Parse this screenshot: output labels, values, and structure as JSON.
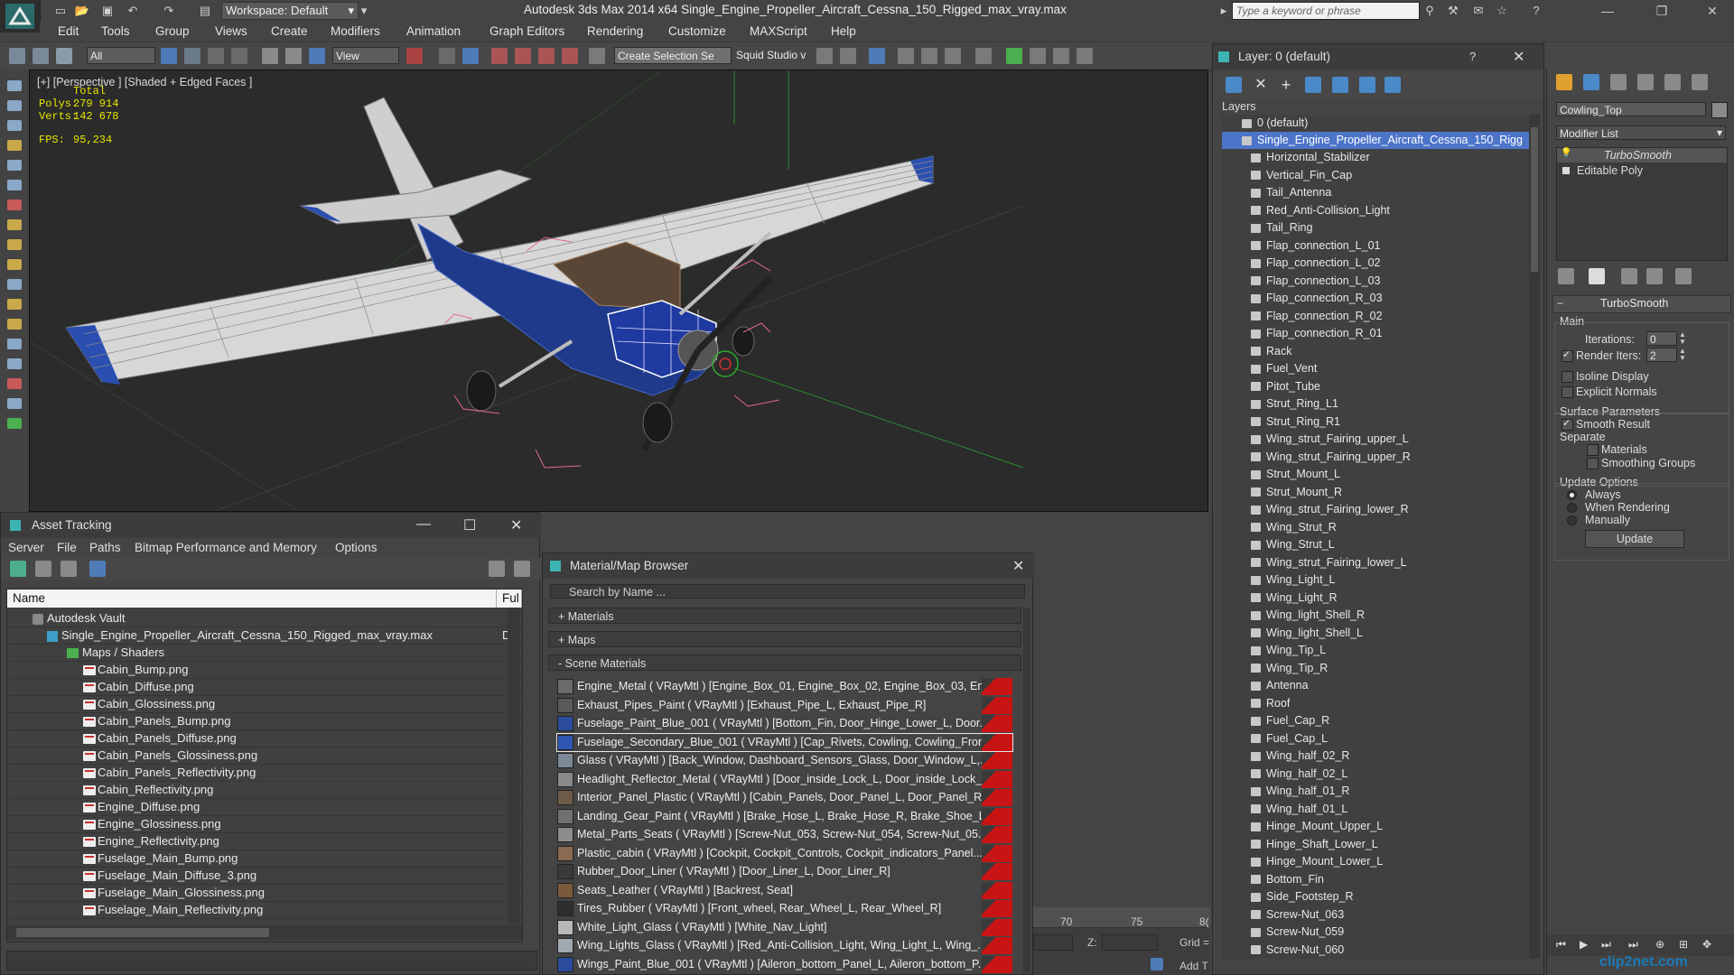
{
  "app": {
    "title": "Autodesk 3ds Max  2014 x64    Single_Engine_Propeller_Aircraft_Cessna_150_Rigged_max_vray.max",
    "workspace": "Workspace: Default",
    "search_placeholder": "Type a keyword or phrase"
  },
  "menu": [
    "Edit",
    "Tools",
    "Group",
    "Views",
    "Create",
    "Modifiers",
    "Animation",
    "Graph Editors",
    "Rendering",
    "Customize",
    "MAXScript",
    "Help"
  ],
  "toolbar": {
    "filter": "All",
    "ref_coord": "View",
    "selection_set": "Create Selection Se",
    "squid": "Squid Studio v"
  },
  "viewport": {
    "label": "[+] [Perspective ] [Shaded + Edged Faces ]",
    "stats": {
      "total_label": "Total",
      "polys_label": "Polys:",
      "polys": "279 914",
      "verts_label": "Verts:",
      "verts": "142 678",
      "fps_label": "FPS:",
      "fps": "95,234"
    }
  },
  "asset_tracking": {
    "title": "Asset Tracking",
    "menu": [
      "Server",
      "File",
      "Paths",
      "Bitmap Performance and Memory",
      "Options"
    ],
    "col_name": "Name",
    "col_full": "Ful",
    "vault": "Autodesk Vault",
    "file": "Single_Engine_Propeller_Aircraft_Cessna_150_Rigged_max_vray.max",
    "file_path": "D:\\",
    "maps_folder": "Maps / Shaders",
    "maps": [
      "Cabin_Bump.png",
      "Cabin_Diffuse.png",
      "Cabin_Glossiness.png",
      "Cabin_Panels_Bump.png",
      "Cabin_Panels_Diffuse.png",
      "Cabin_Panels_Glossiness.png",
      "Cabin_Panels_Reflectivity.png",
      "Cabin_Reflectivity.png",
      "Engine_Diffuse.png",
      "Engine_Glossiness.png",
      "Engine_Reflectivity.png",
      "Fuselage_Main_Bump.png",
      "Fuselage_Main_Diffuse_3.png",
      "Fuselage_Main_Glossiness.png",
      "Fuselage_Main_Reflectivity.png"
    ]
  },
  "material_browser": {
    "title": "Material/Map Browser",
    "search_placeholder": "Search by Name ...",
    "sections": [
      "+ Materials",
      "+ Maps",
      "- Scene Materials"
    ],
    "materials": [
      {
        "text": "Engine_Metal  ( VRayMtl )  [Engine_Box_01, Engine_Box_02, Engine_Box_03, En...",
        "color": "#6a6a6a"
      },
      {
        "text": "Exhaust_Pipes_Paint  ( VRayMtl ) [Exhaust_Pipe_L, Exhaust_Pipe_R]",
        "color": "#5a5a5a"
      },
      {
        "text": "Fuselage_Paint_Blue_001  ( VRayMtl ) [Bottom_Fin, Door_Hinge_Lower_L, Door...",
        "color": "#2b4c9c"
      },
      {
        "text": "Fuselage_Secondary_Blue_001  ( VRayMtl ) [Cap_Rivets, Cowling, Cowling_Fron...",
        "color": "#2e58b0"
      },
      {
        "text": "Glass  ( VRayMtl ) [Back_Window, Dashboard_Sensors_Glass, Door_Window_L,...",
        "color": "#7c8a96"
      },
      {
        "text": "Headlight_Reflector_Metal  ( VRayMtl ) [Door_inside_Lock_L, Door_inside_Lock_...",
        "color": "#8a8a8a"
      },
      {
        "text": "Interior_Panel_Plastic  ( VRayMtl ) [Cabin_Panels, Door_Panel_L, Door_Panel_R,...",
        "color": "#6e5a48"
      },
      {
        "text": "Landing_Gear_Paint  ( VRayMtl ) [Brake_Hose_L, Brake_Hose_R, Brake_Shoe_L,...",
        "color": "#707070"
      },
      {
        "text": "Metal_Parts_Seats  ( VRayMtl ) [Screw-Nut_053, Screw-Nut_054, Screw-Nut_05...",
        "color": "#8c8c8c"
      },
      {
        "text": "Plastic_cabin  ( VRayMtl ) [Cockpit, Cockpit_Controls, Cockpit_indicators_Panel...",
        "color": "#8a6a52"
      },
      {
        "text": "Rubber_Door_Liner  ( VRayMtl ) [Door_Liner_L, Door_Liner_R]",
        "color": "#3a3a3a"
      },
      {
        "text": "Seats_Leather  ( VRayMtl ) [Backrest, Seat]",
        "color": "#7a5a3a"
      },
      {
        "text": "Tires_Rubber  ( VRayMtl ) [Front_wheel, Rear_Wheel_L, Rear_Wheel_R]",
        "color": "#2e2e2e"
      },
      {
        "text": "White_Light_Glass  ( VRayMtl ) [White_Nav_Light]",
        "color": "#b8b8b8"
      },
      {
        "text": "Wing_Lights_Glass  ( VRayMtl ) [Red_Anti-Collision_Light, Wing_Light_L, Wing_...",
        "color": "#a0a8b0"
      },
      {
        "text": "Wings_Paint_Blue_001  ( VRayMtl ) [Aileron_bottom_Panel_L, Aileron_bottom_P...",
        "color": "#2b4c9c"
      }
    ]
  },
  "timeline": {
    "ticks": [
      "70",
      "75",
      "8("
    ],
    "z_label": "Z:",
    "grid_label": "Grid =",
    "add_label": "Add T"
  },
  "layer_explorer": {
    "title": "Layer: 0 (default)",
    "help": "?",
    "header": "Layers",
    "default_layer": "0 (default)",
    "selected": "Single_Engine_Propeller_Aircraft_Cessna_150_Rigg",
    "items": [
      "Horizontal_Stabilizer",
      "Vertical_Fin_Cap",
      "Tail_Antenna",
      "Red_Anti-Collision_Light",
      "Tail_Ring",
      "Flap_connection_L_01",
      "Flap_connection_L_02",
      "Flap_connection_L_03",
      "Flap_connection_R_03",
      "Flap_connection_R_02",
      "Flap_connection_R_01",
      "Rack",
      "Fuel_Vent",
      "Pitot_Tube",
      "Strut_Ring_L1",
      "Strut_Ring_R1",
      "Wing_strut_Fairing_upper_L",
      "Wing_strut_Fairing_upper_R",
      "Strut_Mount_L",
      "Strut_Mount_R",
      "Wing_strut_Fairing_lower_R",
      "Wing_Strut_R",
      "Wing_Strut_L",
      "Wing_strut_Fairing_lower_L",
      "Wing_Light_L",
      "Wing_Light_R",
      "Wing_light_Shell_R",
      "Wing_light_Shell_L",
      "Wing_Tip_L",
      "Wing_Tip_R",
      "Antenna",
      "Roof",
      "Fuel_Cap_R",
      "Fuel_Cap_L",
      "Wing_half_02_R",
      "Wing_half_02_L",
      "Wing_half_01_R",
      "Wing_half_01_L",
      "Hinge_Mount_Upper_L",
      "Hinge_Shaft_Lower_L",
      "Hinge_Mount_Lower_L",
      "Bottom_Fin",
      "Side_Footstep_R",
      "Screw-Nut_063",
      "Screw-Nut_059",
      "Screw-Nut_060"
    ]
  },
  "command_panel": {
    "object_name": "Cowling_Top",
    "modifier_list": "Modifier List",
    "stack": [
      "TurboSmooth",
      "Editable Poly"
    ],
    "rollout_title": "TurboSmooth",
    "main_label": "Main",
    "iterations_label": "Iterations:",
    "iterations": "0",
    "render_iters_label": "Render Iters:",
    "render_iters": "2",
    "isoline": "Isoline Display",
    "explicit_normals": "Explicit Normals",
    "surface_params": "Surface Parameters",
    "smooth_result": "Smooth Result",
    "separate": "Separate",
    "materials": "Materials",
    "smoothing_groups": "Smoothing Groups",
    "update_options": "Update Options",
    "always": "Always",
    "when_rendering": "When Rendering",
    "manually": "Manually",
    "update_button": "Update"
  },
  "watermark": "clip2net.com"
}
